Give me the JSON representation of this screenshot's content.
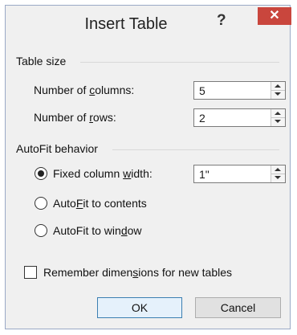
{
  "dialog": {
    "title": "Insert Table",
    "help_glyph": "?",
    "close_glyph": "✕"
  },
  "table_size": {
    "heading": "Table size",
    "columns": {
      "label_pre": "Number of ",
      "label_key": "c",
      "label_post": "olumns:",
      "value": "5"
    },
    "rows": {
      "label_pre": "Number of ",
      "label_key": "r",
      "label_post": "ows:",
      "value": "2"
    }
  },
  "autofit": {
    "heading": "AutoFit behavior",
    "fixed": {
      "label_pre": "Fixed column ",
      "label_key": "w",
      "label_post": "idth:",
      "value": "1\"",
      "selected": true
    },
    "contents": {
      "label_pre": "Auto",
      "label_key": "F",
      "label_post": "it to contents",
      "selected": false
    },
    "window": {
      "label_pre": "AutoFit to win",
      "label_key": "d",
      "label_post": "ow",
      "selected": false
    }
  },
  "remember": {
    "label_pre": "Remember dimen",
    "label_key": "s",
    "label_post": "ions for new tables",
    "checked": false
  },
  "buttons": {
    "ok": "OK",
    "cancel": "Cancel"
  },
  "colors": {
    "close_bg": "#c9463d",
    "ok_border": "#3c7fb1",
    "dialog_border": "#9aa9c6"
  }
}
